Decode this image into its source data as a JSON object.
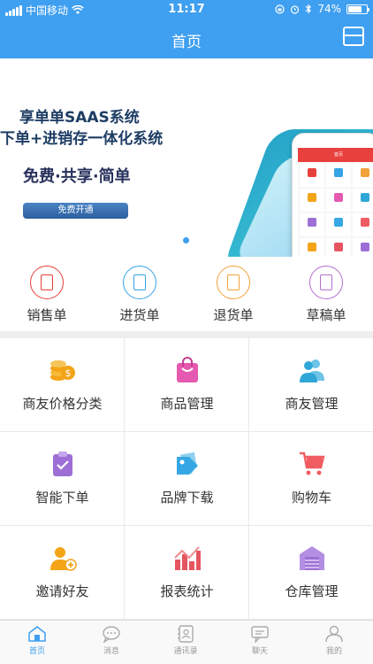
{
  "status_bar": {
    "carrier": "中国移动",
    "time": "11:17",
    "battery": "74%",
    "battery_level": 0.74
  },
  "nav": {
    "title": "首页",
    "menu_icon": "menu-icon"
  },
  "banner": {
    "line1": "享单单SAAS系统",
    "line2": "下单+进销存一体化系统",
    "line3": "免费·共享·简单",
    "button": "免费开通",
    "phone_screen_title": "首页"
  },
  "quick_actions": [
    {
      "label": "销售单",
      "icon": "sales-order-icon",
      "color": "#e8403c"
    },
    {
      "label": "进货单",
      "icon": "purchase-order-icon",
      "color": "#35a3e6"
    },
    {
      "label": "退货单",
      "icon": "return-order-icon",
      "color": "#f2a13b"
    },
    {
      "label": "草稿单",
      "icon": "draft-order-icon",
      "color": "#b56fd1"
    }
  ],
  "grid": [
    {
      "label": "商友价格分类",
      "icon": "coins-icon",
      "color": "#f3a417"
    },
    {
      "label": "商品管理",
      "icon": "shopping-bag-icon",
      "color": "#e55ab0"
    },
    {
      "label": "商友管理",
      "icon": "contacts-icon",
      "color": "#2fa7d6"
    },
    {
      "label": "智能下单",
      "icon": "clipboard-check-icon",
      "color": "#9d6fd6"
    },
    {
      "label": "品牌下载",
      "icon": "tag-icon",
      "color": "#36a7e4"
    },
    {
      "label": "购物车",
      "icon": "cart-icon",
      "color": "#ef5d63"
    },
    {
      "label": "邀请好友",
      "icon": "invite-user-icon",
      "color": "#f3a417"
    },
    {
      "label": "报表统计",
      "icon": "report-chart-icon",
      "color": "#e5555f"
    },
    {
      "label": "仓库管理",
      "icon": "warehouse-icon",
      "color": "#9d6fd6"
    }
  ],
  "tabbar": [
    {
      "label": "首页",
      "icon": "home-icon",
      "active": true
    },
    {
      "label": "消息",
      "icon": "message-icon",
      "active": false
    },
    {
      "label": "通讯录",
      "icon": "address-book-icon",
      "active": false
    },
    {
      "label": "聊天",
      "icon": "chat-icon",
      "active": false
    },
    {
      "label": "我的",
      "icon": "profile-icon",
      "active": false
    }
  ],
  "colors": {
    "primary": "#3f9ff0",
    "divider": "#e8e8e8",
    "text": "#333333"
  }
}
